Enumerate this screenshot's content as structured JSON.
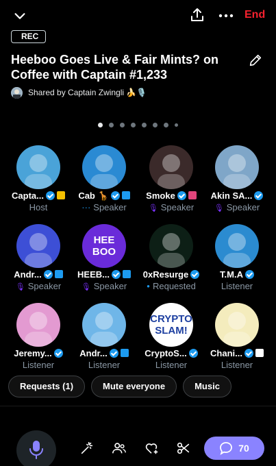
{
  "header": {
    "end_label": "End",
    "rec_label": "REC",
    "title": "Heeboo Goes Live & Fair Mints? on Coffee with Captain #1,233",
    "shared_by": "Shared by Captain Zwingli 🍌🎙️"
  },
  "pager": {
    "total": 8,
    "active": 0
  },
  "participants": [
    {
      "name": "Capta...",
      "role": "Host",
      "role_mark": "",
      "badge_color": "#f5c000",
      "avatar_color": "#4aa3d8"
    },
    {
      "name": "Cab 🦒",
      "role": "Speaker",
      "role_mark": "···",
      "badge_color": "#1d9bf0",
      "avatar_color": "#2a8ad3"
    },
    {
      "name": "Smoke",
      "role": "Speaker",
      "role_mark": "mic-off",
      "badge_color": "#e0457b",
      "avatar_color": "#3b2a2a"
    },
    {
      "name": "Akin SA...",
      "role": "Speaker",
      "role_mark": "mic-off",
      "badge_color": "",
      "avatar_color": "#7fa6c8"
    },
    {
      "name": "Andr...",
      "role": "Speaker",
      "role_mark": "mic-off",
      "badge_color": "#1d9bf0",
      "avatar_color": "#3d4fd6"
    },
    {
      "name": "HEEB...",
      "role": "Speaker",
      "role_mark": "mic-off",
      "badge_color": "#1d9bf0",
      "avatar_color": "#6a2bd9",
      "avatar_text": "HEE BOO"
    },
    {
      "name": "0xResurge",
      "role": "Requested",
      "role_mark": "dot",
      "badge_color": "",
      "avatar_color": "#0d1f16"
    },
    {
      "name": "T.M.A",
      "role": "Listener",
      "role_mark": "",
      "badge_color": "",
      "avatar_color": "#2b8bd0"
    },
    {
      "name": "Jeremy...",
      "role": "Listener",
      "role_mark": "",
      "badge_color": "",
      "avatar_color": "#e39ad1"
    },
    {
      "name": "Andr...",
      "role": "Listener",
      "role_mark": "",
      "badge_color": "#1d9bf0",
      "avatar_color": "#6fb6e8"
    },
    {
      "name": "CryptoS...",
      "role": "Listener",
      "role_mark": "",
      "badge_color": "",
      "avatar_color": "#ffffff",
      "avatar_text": "CRYPTO SLAM!"
    },
    {
      "name": "Chani...",
      "role": "Listener",
      "role_mark": "",
      "badge_color": "#ffffff",
      "avatar_color": "#f4ecbd"
    }
  ],
  "chips": {
    "requests": "Requests (1)",
    "mute": "Mute everyone",
    "music": "Music"
  },
  "footer": {
    "chat_count": "70"
  },
  "colors": {
    "accent": "#8a83ff",
    "end": "#f4212e",
    "verified": "#1d9bf0",
    "mic_off": "#f91880"
  }
}
